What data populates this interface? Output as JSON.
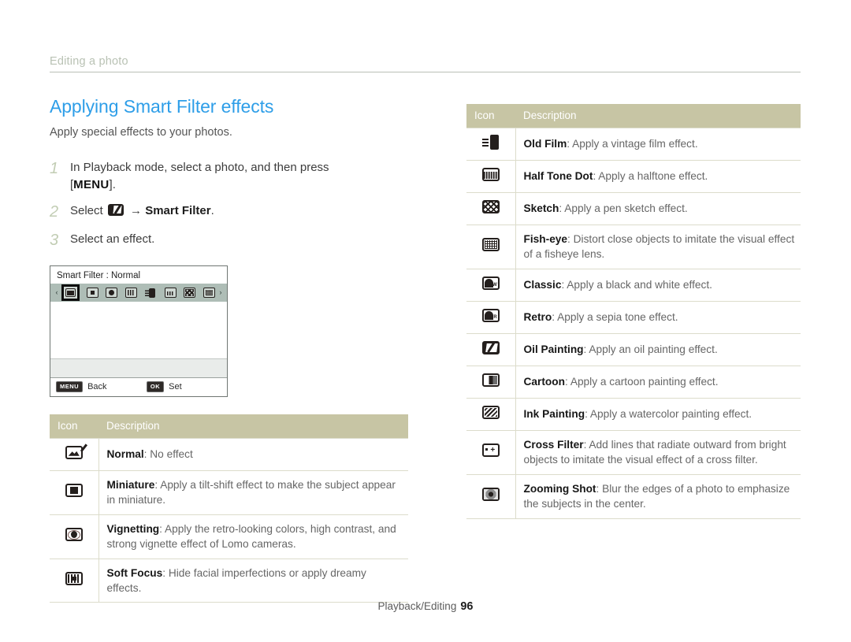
{
  "breadcrumb": "Editing a photo",
  "page": {
    "title": "Applying Smart Filter effects",
    "subtitle": "Apply special effects to your photos."
  },
  "steps": [
    {
      "num": "1",
      "text_before": "In Playback mode, select a photo, and then press ",
      "key": "MENU",
      "text_after": "]."
    },
    {
      "num": "2",
      "text_before": "Select ",
      "icon": "edit-icon",
      "arrow": "→",
      "bold": "Smart Filter",
      "text_after": "."
    },
    {
      "num": "3",
      "text_before": "Select an effect.",
      "key": "",
      "text_after": ""
    }
  ],
  "camera_screen": {
    "title": "Smart Filter : Normal",
    "left_arrow": "‹",
    "right_arrow": "›",
    "strip_icons": [
      "normal-icon",
      "miniature-icon",
      "vignetting-icon",
      "soft-focus-icon",
      "old-film-icon",
      "half-tone-dot-icon",
      "sketch-icon",
      "fish-eye-icon"
    ],
    "selected_index": 0,
    "footer": {
      "menu_key": "MENU",
      "menu_label": "Back",
      "ok_key": "OK",
      "ok_label": "Set"
    }
  },
  "tables": {
    "headers": {
      "icon": "Icon",
      "description": "Description"
    },
    "left_rows": [
      {
        "icon": "normal-icon",
        "icon_class": "normal",
        "name": "Normal",
        "desc": ": No effect"
      },
      {
        "icon": "miniature-icon",
        "icon_class": "miniature",
        "name": "Miniature",
        "desc": ": Apply a tilt-shift effect to make the subject appear in miniature."
      },
      {
        "icon": "vignetting-icon",
        "icon_class": "vignette",
        "name": "Vignetting",
        "desc": ": Apply the retro-looking colors, high contrast, and strong vignette effect of Lomo cameras."
      },
      {
        "icon": "soft-focus-icon",
        "icon_class": "soft",
        "name": "Soft Focus",
        "desc": ": Hide facial imperfections or apply dreamy effects."
      }
    ],
    "right_rows": [
      {
        "icon": "old-film-icon",
        "icon_class": "oldfilm",
        "name": "Old Film",
        "desc": ": Apply a vintage film effect."
      },
      {
        "icon": "half-tone-dot-icon",
        "icon_class": "halftone",
        "name": "Half Tone Dot",
        "desc": ": Apply a halftone effect."
      },
      {
        "icon": "sketch-icon",
        "icon_class": "sketch",
        "name": "Sketch",
        "desc": ": Apply a pen sketch effect."
      },
      {
        "icon": "fish-eye-icon",
        "icon_class": "fisheye",
        "name": "Fish-eye",
        "desc": ": Distort close objects to imitate the visual effect of a fisheye lens."
      },
      {
        "icon": "classic-icon",
        "icon_class": "classic",
        "name": "Classic",
        "desc": ": Apply a black and white effect."
      },
      {
        "icon": "retro-icon",
        "icon_class": "retro",
        "name": "Retro",
        "desc": ": Apply a sepia tone effect."
      },
      {
        "icon": "oil-painting-icon",
        "icon_class": "oilpaint",
        "name": "Oil Painting",
        "desc": ": Apply an oil painting effect."
      },
      {
        "icon": "cartoon-icon",
        "icon_class": "cartoon",
        "name": "Cartoon",
        "desc": ": Apply a cartoon painting effect."
      },
      {
        "icon": "ink-painting-icon",
        "icon_class": "inkpaint",
        "name": "Ink Painting",
        "desc": ": Apply a watercolor painting effect."
      },
      {
        "icon": "cross-filter-icon",
        "icon_class": "cross",
        "name": "Cross Filter",
        "desc": ": Add lines that radiate outward from bright objects to imitate the visual effect of a cross filter."
      },
      {
        "icon": "zooming-shot-icon",
        "icon_class": "zoom",
        "name": "Zooming Shot",
        "desc": ": Blur the edges of a photo to emphasize the subjects in the center."
      }
    ]
  },
  "footer": {
    "section": "Playback/Editing",
    "page_number": "96"
  },
  "colors": {
    "title_blue": "#2e9ee8",
    "table_header": "#c7c5a4",
    "step_number": "#c2cdb4",
    "breadcrumb": "#b9c2b4",
    "screen_strip": "#aebdb6"
  }
}
